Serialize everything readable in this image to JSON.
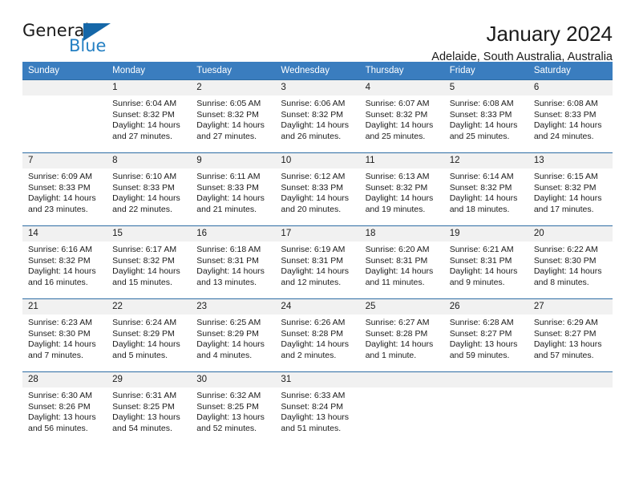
{
  "brand": {
    "name_dark": "General",
    "name_blue": "Blue",
    "accent_color": "#2580c3",
    "triangle_color": "#1567a8"
  },
  "header": {
    "title": "January 2024",
    "subtitle": "Adelaide, South Australia, Australia"
  },
  "theme": {
    "header_row_bg": "#3a7dbf",
    "header_row_text": "#ffffff",
    "daynum_band_bg": "#f1f1f1",
    "row_divider": "#2e6da4",
    "body_text": "#1b1b1b",
    "page_bg": "#ffffff"
  },
  "weekday_headers": [
    "Sunday",
    "Monday",
    "Tuesday",
    "Wednesday",
    "Thursday",
    "Friday",
    "Saturday"
  ],
  "labels": {
    "sunrise_prefix": "Sunrise:",
    "sunset_prefix": "Sunset:",
    "daylight_prefix": "Daylight:"
  },
  "weeks": [
    [
      {
        "day": "",
        "empty": true,
        "sunrise": "",
        "sunset": "",
        "daylight_1": "",
        "daylight_2": ""
      },
      {
        "day": "1",
        "sunrise": "Sunrise: 6:04 AM",
        "sunset": "Sunset: 8:32 PM",
        "daylight_1": "Daylight: 14 hours",
        "daylight_2": "and 27 minutes."
      },
      {
        "day": "2",
        "sunrise": "Sunrise: 6:05 AM",
        "sunset": "Sunset: 8:32 PM",
        "daylight_1": "Daylight: 14 hours",
        "daylight_2": "and 27 minutes."
      },
      {
        "day": "3",
        "sunrise": "Sunrise: 6:06 AM",
        "sunset": "Sunset: 8:32 PM",
        "daylight_1": "Daylight: 14 hours",
        "daylight_2": "and 26 minutes."
      },
      {
        "day": "4",
        "sunrise": "Sunrise: 6:07 AM",
        "sunset": "Sunset: 8:32 PM",
        "daylight_1": "Daylight: 14 hours",
        "daylight_2": "and 25 minutes."
      },
      {
        "day": "5",
        "sunrise": "Sunrise: 6:08 AM",
        "sunset": "Sunset: 8:33 PM",
        "daylight_1": "Daylight: 14 hours",
        "daylight_2": "and 25 minutes."
      },
      {
        "day": "6",
        "sunrise": "Sunrise: 6:08 AM",
        "sunset": "Sunset: 8:33 PM",
        "daylight_1": "Daylight: 14 hours",
        "daylight_2": "and 24 minutes."
      }
    ],
    [
      {
        "day": "7",
        "sunrise": "Sunrise: 6:09 AM",
        "sunset": "Sunset: 8:33 PM",
        "daylight_1": "Daylight: 14 hours",
        "daylight_2": "and 23 minutes."
      },
      {
        "day": "8",
        "sunrise": "Sunrise: 6:10 AM",
        "sunset": "Sunset: 8:33 PM",
        "daylight_1": "Daylight: 14 hours",
        "daylight_2": "and 22 minutes."
      },
      {
        "day": "9",
        "sunrise": "Sunrise: 6:11 AM",
        "sunset": "Sunset: 8:33 PM",
        "daylight_1": "Daylight: 14 hours",
        "daylight_2": "and 21 minutes."
      },
      {
        "day": "10",
        "sunrise": "Sunrise: 6:12 AM",
        "sunset": "Sunset: 8:33 PM",
        "daylight_1": "Daylight: 14 hours",
        "daylight_2": "and 20 minutes."
      },
      {
        "day": "11",
        "sunrise": "Sunrise: 6:13 AM",
        "sunset": "Sunset: 8:32 PM",
        "daylight_1": "Daylight: 14 hours",
        "daylight_2": "and 19 minutes."
      },
      {
        "day": "12",
        "sunrise": "Sunrise: 6:14 AM",
        "sunset": "Sunset: 8:32 PM",
        "daylight_1": "Daylight: 14 hours",
        "daylight_2": "and 18 minutes."
      },
      {
        "day": "13",
        "sunrise": "Sunrise: 6:15 AM",
        "sunset": "Sunset: 8:32 PM",
        "daylight_1": "Daylight: 14 hours",
        "daylight_2": "and 17 minutes."
      }
    ],
    [
      {
        "day": "14",
        "sunrise": "Sunrise: 6:16 AM",
        "sunset": "Sunset: 8:32 PM",
        "daylight_1": "Daylight: 14 hours",
        "daylight_2": "and 16 minutes."
      },
      {
        "day": "15",
        "sunrise": "Sunrise: 6:17 AM",
        "sunset": "Sunset: 8:32 PM",
        "daylight_1": "Daylight: 14 hours",
        "daylight_2": "and 15 minutes."
      },
      {
        "day": "16",
        "sunrise": "Sunrise: 6:18 AM",
        "sunset": "Sunset: 8:31 PM",
        "daylight_1": "Daylight: 14 hours",
        "daylight_2": "and 13 minutes."
      },
      {
        "day": "17",
        "sunrise": "Sunrise: 6:19 AM",
        "sunset": "Sunset: 8:31 PM",
        "daylight_1": "Daylight: 14 hours",
        "daylight_2": "and 12 minutes."
      },
      {
        "day": "18",
        "sunrise": "Sunrise: 6:20 AM",
        "sunset": "Sunset: 8:31 PM",
        "daylight_1": "Daylight: 14 hours",
        "daylight_2": "and 11 minutes."
      },
      {
        "day": "19",
        "sunrise": "Sunrise: 6:21 AM",
        "sunset": "Sunset: 8:31 PM",
        "daylight_1": "Daylight: 14 hours",
        "daylight_2": "and 9 minutes."
      },
      {
        "day": "20",
        "sunrise": "Sunrise: 6:22 AM",
        "sunset": "Sunset: 8:30 PM",
        "daylight_1": "Daylight: 14 hours",
        "daylight_2": "and 8 minutes."
      }
    ],
    [
      {
        "day": "21",
        "sunrise": "Sunrise: 6:23 AM",
        "sunset": "Sunset: 8:30 PM",
        "daylight_1": "Daylight: 14 hours",
        "daylight_2": "and 7 minutes."
      },
      {
        "day": "22",
        "sunrise": "Sunrise: 6:24 AM",
        "sunset": "Sunset: 8:29 PM",
        "daylight_1": "Daylight: 14 hours",
        "daylight_2": "and 5 minutes."
      },
      {
        "day": "23",
        "sunrise": "Sunrise: 6:25 AM",
        "sunset": "Sunset: 8:29 PM",
        "daylight_1": "Daylight: 14 hours",
        "daylight_2": "and 4 minutes."
      },
      {
        "day": "24",
        "sunrise": "Sunrise: 6:26 AM",
        "sunset": "Sunset: 8:28 PM",
        "daylight_1": "Daylight: 14 hours",
        "daylight_2": "and 2 minutes."
      },
      {
        "day": "25",
        "sunrise": "Sunrise: 6:27 AM",
        "sunset": "Sunset: 8:28 PM",
        "daylight_1": "Daylight: 14 hours",
        "daylight_2": "and 1 minute."
      },
      {
        "day": "26",
        "sunrise": "Sunrise: 6:28 AM",
        "sunset": "Sunset: 8:27 PM",
        "daylight_1": "Daylight: 13 hours",
        "daylight_2": "and 59 minutes."
      },
      {
        "day": "27",
        "sunrise": "Sunrise: 6:29 AM",
        "sunset": "Sunset: 8:27 PM",
        "daylight_1": "Daylight: 13 hours",
        "daylight_2": "and 57 minutes."
      }
    ],
    [
      {
        "day": "28",
        "sunrise": "Sunrise: 6:30 AM",
        "sunset": "Sunset: 8:26 PM",
        "daylight_1": "Daylight: 13 hours",
        "daylight_2": "and 56 minutes."
      },
      {
        "day": "29",
        "sunrise": "Sunrise: 6:31 AM",
        "sunset": "Sunset: 8:25 PM",
        "daylight_1": "Daylight: 13 hours",
        "daylight_2": "and 54 minutes."
      },
      {
        "day": "30",
        "sunrise": "Sunrise: 6:32 AM",
        "sunset": "Sunset: 8:25 PM",
        "daylight_1": "Daylight: 13 hours",
        "daylight_2": "and 52 minutes."
      },
      {
        "day": "31",
        "sunrise": "Sunrise: 6:33 AM",
        "sunset": "Sunset: 8:24 PM",
        "daylight_1": "Daylight: 13 hours",
        "daylight_2": "and 51 minutes."
      },
      {
        "day": "",
        "empty": true,
        "sunrise": "",
        "sunset": "",
        "daylight_1": "",
        "daylight_2": ""
      },
      {
        "day": "",
        "empty": true,
        "sunrise": "",
        "sunset": "",
        "daylight_1": "",
        "daylight_2": ""
      },
      {
        "day": "",
        "empty": true,
        "sunrise": "",
        "sunset": "",
        "daylight_1": "",
        "daylight_2": ""
      }
    ]
  ]
}
